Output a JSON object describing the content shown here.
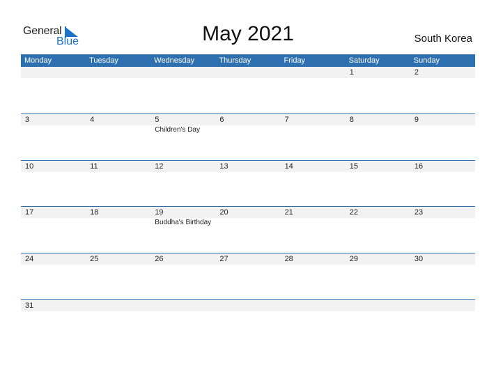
{
  "logo": {
    "line1": "General",
    "line2": "Blue",
    "accent_color": "#1a73c8"
  },
  "title": "May 2021",
  "country": "South Korea",
  "colors": {
    "header_bg": "#2e6fb0",
    "strip_bg": "#f2f2f2"
  },
  "weekdays": [
    "Monday",
    "Tuesday",
    "Wednesday",
    "Thursday",
    "Friday",
    "Saturday",
    "Sunday"
  ],
  "weeks": [
    {
      "days": [
        {
          "n": ""
        },
        {
          "n": ""
        },
        {
          "n": ""
        },
        {
          "n": ""
        },
        {
          "n": ""
        },
        {
          "n": "1"
        },
        {
          "n": "2"
        }
      ]
    },
    {
      "days": [
        {
          "n": "3"
        },
        {
          "n": "4"
        },
        {
          "n": "5",
          "event": "Children's Day"
        },
        {
          "n": "6"
        },
        {
          "n": "7"
        },
        {
          "n": "8"
        },
        {
          "n": "9"
        }
      ]
    },
    {
      "days": [
        {
          "n": "10"
        },
        {
          "n": "11"
        },
        {
          "n": "12"
        },
        {
          "n": "13"
        },
        {
          "n": "14"
        },
        {
          "n": "15"
        },
        {
          "n": "16"
        }
      ]
    },
    {
      "days": [
        {
          "n": "17"
        },
        {
          "n": "18"
        },
        {
          "n": "19",
          "event": "Buddha's Birthday"
        },
        {
          "n": "20"
        },
        {
          "n": "21"
        },
        {
          "n": "22"
        },
        {
          "n": "23"
        }
      ]
    },
    {
      "days": [
        {
          "n": "24"
        },
        {
          "n": "25"
        },
        {
          "n": "26"
        },
        {
          "n": "27"
        },
        {
          "n": "28"
        },
        {
          "n": "29"
        },
        {
          "n": "30"
        }
      ]
    },
    {
      "days": [
        {
          "n": "31"
        },
        {
          "n": ""
        },
        {
          "n": ""
        },
        {
          "n": ""
        },
        {
          "n": ""
        },
        {
          "n": ""
        },
        {
          "n": ""
        }
      ]
    }
  ]
}
